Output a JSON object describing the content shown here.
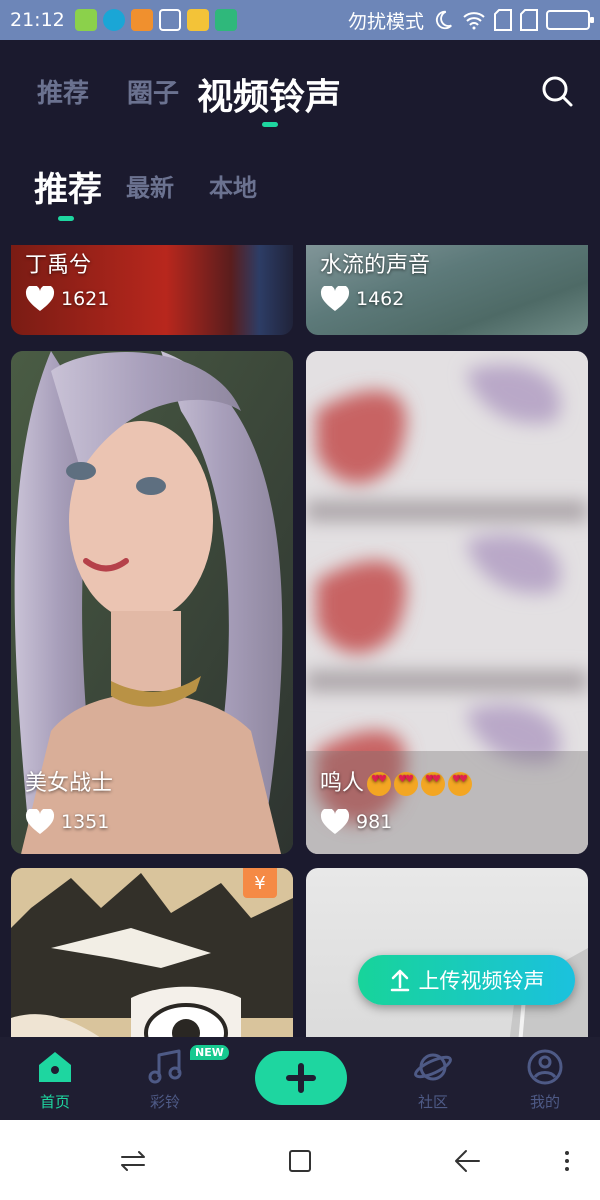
{
  "status_bar": {
    "time": "21:12",
    "dnd_text": "勿扰模式",
    "left_icons": [
      "app-notify-icon",
      "sync-icon",
      "warning-icon",
      "brush-icon",
      "folder-icon",
      "usb-icon"
    ],
    "right_icons": [
      "moon-icon",
      "wifi-icon",
      "sim-icon",
      "sim-icon",
      "battery-icon"
    ]
  },
  "header": {
    "tabs": [
      {
        "label": "推荐",
        "active": false
      },
      {
        "label": "圈子",
        "active": false
      },
      {
        "label": "视频铃声",
        "active": true
      }
    ],
    "accent_color": "#1ed6a0"
  },
  "subtabs": [
    {
      "label": "推荐",
      "active": true
    },
    {
      "label": "最新",
      "active": false
    },
    {
      "label": "本地",
      "active": false
    }
  ],
  "cards": [
    {
      "title": "丁禹兮",
      "likes": "1621"
    },
    {
      "title": "水流的声音",
      "likes": "1462"
    },
    {
      "title": "美女战士",
      "likes": "1351"
    },
    {
      "title": "鸣人",
      "likes": "981",
      "emoji_count": 4,
      "emoji": "heart-eyes-emoji"
    },
    {
      "title": "",
      "likes": "",
      "paid_badge": "¥"
    },
    {
      "title": "",
      "likes": ""
    }
  ],
  "upload_button": {
    "label": "上传视频铃声",
    "icon": "upload-arrow-icon"
  },
  "bottom_nav": {
    "items": [
      {
        "label": "首页",
        "icon": "home-icon",
        "active": true
      },
      {
        "label": "彩铃",
        "icon": "music-note-icon",
        "active": false,
        "badge": "NEW"
      },
      {
        "label": "",
        "icon": "plus-icon",
        "active": false
      },
      {
        "label": "社区",
        "icon": "planet-icon",
        "active": false
      },
      {
        "label": "我的",
        "icon": "person-icon",
        "active": false
      }
    ]
  },
  "system_nav": [
    "switch-icon",
    "square-icon",
    "back-icon",
    "menu-icon"
  ]
}
